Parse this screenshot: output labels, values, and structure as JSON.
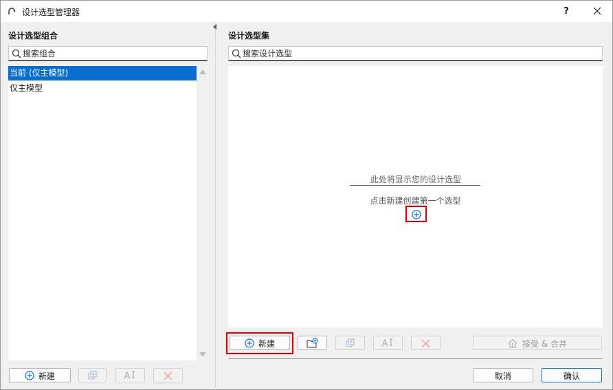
{
  "window": {
    "title": "设计选型管理器",
    "help_label": "?"
  },
  "left_panel": {
    "heading": "设计选型组合",
    "search_placeholder": "搜索组合",
    "items": [
      {
        "label": "当前 (仅主模型)",
        "selected": true
      },
      {
        "label": "仅主模型",
        "selected": false
      }
    ],
    "new_label": "新建"
  },
  "right_panel": {
    "heading": "设计选型集",
    "search_placeholder": "搜索设计选型",
    "empty_text": "此处将显示您的设计选型",
    "empty_hint": "点击新建创建第一个选型",
    "new_label": "新建",
    "accept_merge_label": "接受 & 合并"
  },
  "dialog": {
    "cancel_label": "取消",
    "ok_label": "确认"
  },
  "colors": {
    "accent": "#0a6ed1",
    "highlight": "#e00000",
    "delete_red": "#e8604c"
  },
  "icons": {
    "app": "arc-icon",
    "search": "search-icon",
    "add": "plus-circle-icon",
    "duplicate": "duplicate-icon",
    "rename": "rename-icon",
    "delete": "delete-x-icon",
    "new_folder": "new-folder-icon",
    "accept_merge": "accept-merge-icon",
    "close": "close-icon"
  }
}
